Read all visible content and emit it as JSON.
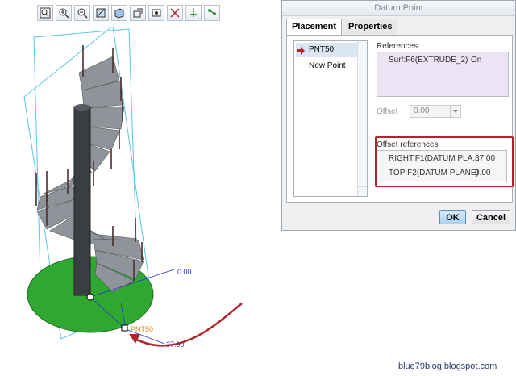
{
  "toolbar": {
    "buttons": [
      {
        "name": "zoom-fit-icon"
      },
      {
        "name": "zoom-in-icon"
      },
      {
        "name": "zoom-out-icon"
      },
      {
        "name": "repaint-icon"
      },
      {
        "name": "shade-icon"
      },
      {
        "name": "saved-views-icon"
      },
      {
        "name": "layers-icon"
      },
      {
        "name": "datum-planes-icon"
      },
      {
        "name": "datum-axes-icon"
      },
      {
        "name": "datum-points-icon"
      }
    ]
  },
  "viewport": {
    "dim_top": "0.00",
    "dim_bottom": "37.00",
    "point_label": "PNT50",
    "colors": {
      "base": "#2fa832",
      "frame": "#59c7e3",
      "dim": "#2a36c9",
      "arrow": "#b0242c",
      "label": "#e08a2a"
    }
  },
  "dialog": {
    "title": "Datum Point",
    "tabs": [
      "Placement",
      "Properties"
    ],
    "points": [
      "PNT50",
      "New Point"
    ],
    "references_label": "References",
    "references": [
      {
        "surface": "Surf:F6(EXTRUDE_2)",
        "constraint": "On"
      }
    ],
    "offset_label": "Offset",
    "offset_value": "0.00",
    "offset_references_label": "Offset references",
    "offset_references": [
      {
        "name": "RIGHT:F1(DATUM PLA...",
        "value": "37.00"
      },
      {
        "name": "TOP:F2(DATUM PLANE)",
        "value": "0.00"
      }
    ],
    "ok_label": "OK",
    "cancel_label": "Cancel"
  },
  "watermark": "blue79blog.blogspot.com"
}
